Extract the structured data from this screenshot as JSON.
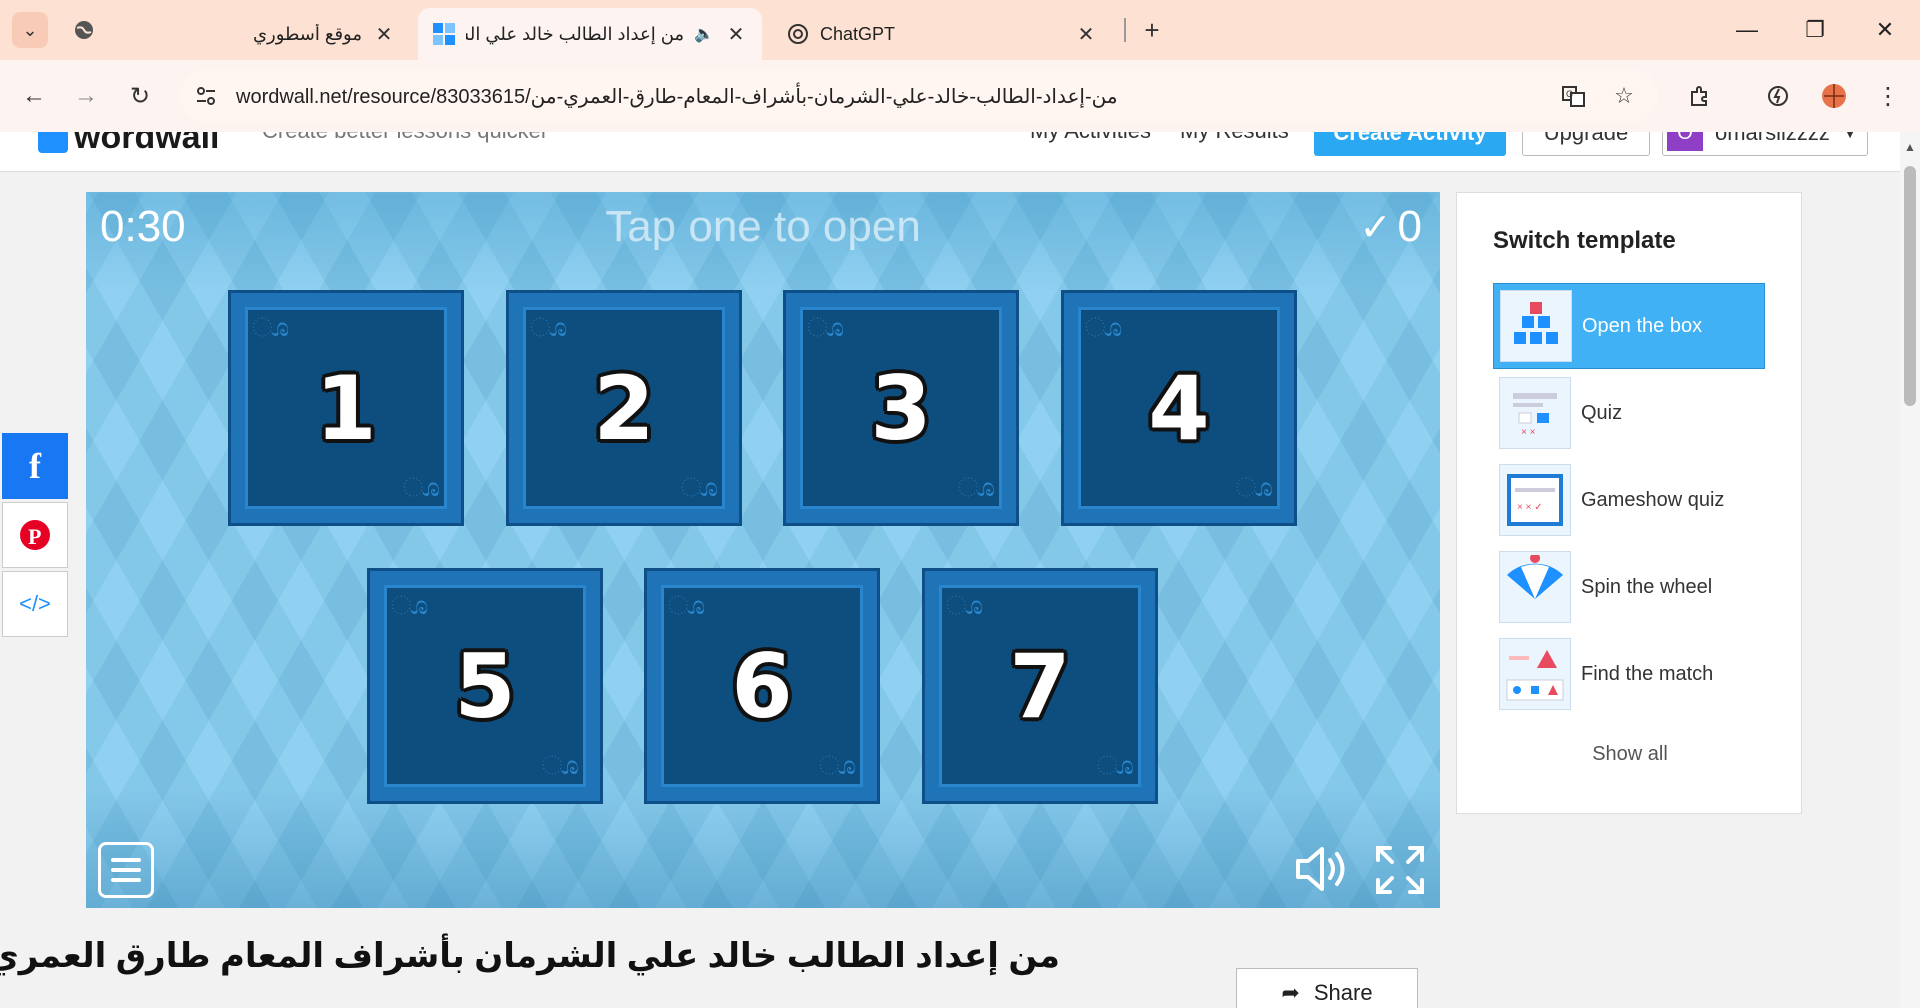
{
  "browser": {
    "tabs": [
      {
        "title": "موقع أسطوري",
        "icon": "globe-icon"
      },
      {
        "title": "من إعداد الطالب خالد علي الش",
        "icon": "wordwall-icon",
        "active": true
      },
      {
        "title": "ChatGPT",
        "icon": "chatgpt-icon"
      }
    ],
    "url": "wordwall.net/resource/83033615/من-إعداد-الطالب-خالد-علي-الشرمان-بأشراف-المعام-طارق-العمري-من"
  },
  "header": {
    "logo": "wordwall",
    "tagline": "Create better lessons quicker",
    "my_activities": "My Activities",
    "my_results": "My Results",
    "create_activity": "Create Activity",
    "upgrade": "Upgrade",
    "user_initial": "O",
    "username": "omarsiizzzz"
  },
  "game": {
    "timer": "0:30",
    "instruction": "Tap one to open",
    "score": "0",
    "boxes": [
      "1",
      "2",
      "3",
      "4",
      "5",
      "6",
      "7"
    ]
  },
  "panel": {
    "title": "Switch template",
    "templates": [
      {
        "label": "Open the box",
        "icon": "open-the-box-icon",
        "active": true
      },
      {
        "label": "Quiz",
        "icon": "quiz-icon"
      },
      {
        "label": "Gameshow quiz",
        "icon": "gameshow-quiz-icon"
      },
      {
        "label": "Spin the wheel",
        "icon": "spin-the-wheel-icon"
      },
      {
        "label": "Find the match",
        "icon": "find-the-match-icon"
      }
    ],
    "show_all": "Show all"
  },
  "activity": {
    "title": "من إعداد الطالب خالد علي الشرمان بأشراف المعام طارق العمري",
    "share": "Share"
  },
  "colors": {
    "accent": "#3fb1f4",
    "box_face": "#0e4e7e",
    "game_bg": "#7fcaef"
  }
}
